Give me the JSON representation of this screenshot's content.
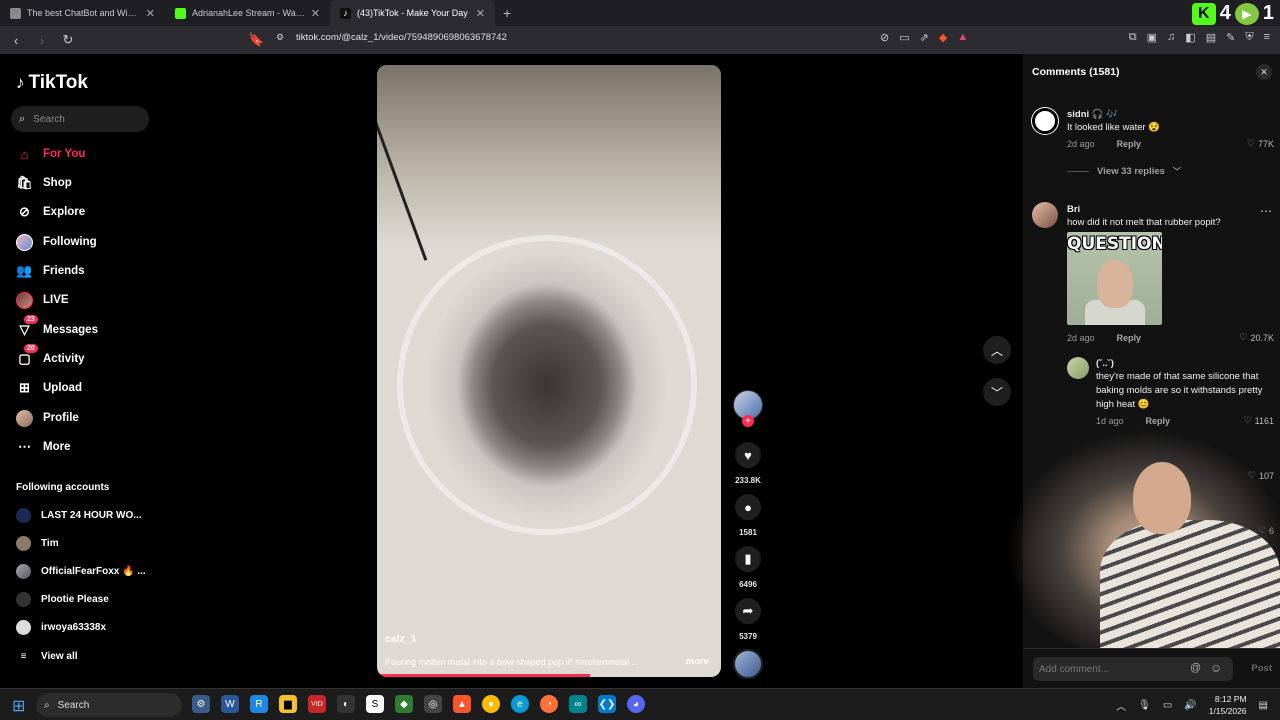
{
  "browser": {
    "tabs": [
      {
        "title": "The best ChatBot and Widgets for Ki",
        "color": "#8a8a8a"
      },
      {
        "title": "AdrianahLee Stream - Watch Live on",
        "color": "#53fc18"
      },
      {
        "title": "(43)TikTok - Make Your Day",
        "color": "#111111"
      }
    ],
    "url": "tiktok.com/@calz_1/video/7594890698063678742",
    "ext_counter_a": "4",
    "ext_counter_b": "1",
    "kick_glyph": "K",
    "rumble_glyph": "▶"
  },
  "sidebar": {
    "logo": "TikTok",
    "search_placeholder": "Search",
    "items": [
      {
        "label": "For You",
        "icon": "home-icon"
      },
      {
        "label": "Shop",
        "icon": "shop-icon"
      },
      {
        "label": "Explore",
        "icon": "compass-icon"
      },
      {
        "label": "Following",
        "icon": "following-icon"
      },
      {
        "label": "Friends",
        "icon": "friends-icon"
      },
      {
        "label": "LIVE",
        "icon": "live-icon"
      },
      {
        "label": "Messages",
        "icon": "messages-icon",
        "badge": "23"
      },
      {
        "label": "Activity",
        "icon": "activity-icon",
        "badge": "20"
      },
      {
        "label": "Upload",
        "icon": "upload-icon"
      },
      {
        "label": "Profile",
        "icon": "profile-icon"
      },
      {
        "label": "More",
        "icon": "more-icon"
      }
    ],
    "following_title": "Following accounts",
    "accounts": [
      {
        "name": "LAST 24 HOUR WO..."
      },
      {
        "name": "Tim"
      },
      {
        "name": "OfficialFearFoxx 🔥 ..."
      },
      {
        "name": "Plootie Please"
      },
      {
        "name": "irwoya63338x"
      }
    ],
    "view_all": "View all"
  },
  "video": {
    "username": "calz_1",
    "description": "Pouring molten metal into a bow shaped pop it! #moltenmetal ...",
    "more": "more",
    "progress": 0.62,
    "likes": "233.8K",
    "comments": "1581",
    "saves": "6496",
    "shares": "5379"
  },
  "comments_panel": {
    "title": "Comments (1581)",
    "comments": [
      {
        "user": "sidni 🎧 🎶",
        "text": "It looked like water 😵",
        "time": "2d ago",
        "reply": "Reply",
        "likes": "77K",
        "view_replies": "View 33 replies"
      },
      {
        "user": "Bri",
        "text": "how did it not melt that rubber popit?",
        "gif_text": "QUESTION:",
        "time": "2d ago",
        "reply": "Reply",
        "likes": "20.7K"
      },
      {
        "user": "(˘..˘)",
        "text": "they're made of that same silicone that baking molds are so it withstands pretty high heat 😊",
        "time": "1d ago",
        "reply": "Reply",
        "likes": "1161"
      },
      {
        "likes": "107"
      },
      {
        "likes": "6"
      }
    ],
    "add_placeholder": "Add comment...",
    "post": "Post"
  },
  "taskbar": {
    "search": "Search",
    "time": "8:12 PM",
    "date": "1/15/2026"
  }
}
